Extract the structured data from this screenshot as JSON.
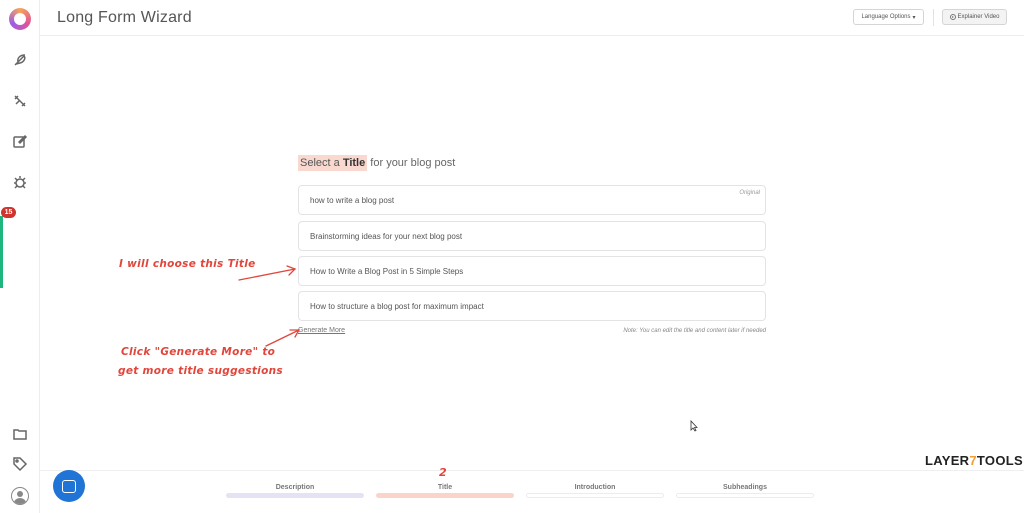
{
  "header": {
    "title": "Long Form Wizard",
    "language_button": "Language Options",
    "explainer_button": "Explainer Video"
  },
  "sidebar": {
    "notification_count": "15",
    "items": [
      {
        "icon": "feather-icon"
      },
      {
        "icon": "tools-icon"
      },
      {
        "icon": "edit-icon"
      },
      {
        "icon": "bug-icon"
      },
      {
        "icon": "folder-icon"
      },
      {
        "icon": "tag-icon"
      },
      {
        "icon": "avatar-icon"
      }
    ]
  },
  "picker": {
    "heading_prefix": "Select a",
    "heading_keyword": "Title",
    "heading_suffix": "for your blog post",
    "original_tag": "Original",
    "options": [
      "how to write a blog post",
      "Brainstorming ideas for your next blog post",
      "How to Write a Blog Post in 5 Simple Steps",
      "How to structure a blog post for maximum impact"
    ],
    "generate_more": "Generate More",
    "note": "Note: You can edit the title and content later if needed"
  },
  "annotations": {
    "choose_title": "I will choose this Title",
    "generate_line1": "Click \"Generate More\" to",
    "generate_line2": "get more title suggestions",
    "step_number": "2"
  },
  "steps": [
    {
      "label": "Description",
      "state": "complete"
    },
    {
      "label": "Title",
      "state": "active"
    },
    {
      "label": "Introduction",
      "state": "pending"
    },
    {
      "label": "Subheadings",
      "state": "pending"
    }
  ],
  "brand": {
    "part1": "LAYER",
    "part2": "7",
    "part3": "TOOLS"
  },
  "colors": {
    "accent": "#e0463b",
    "highlight": "#f8d8cf",
    "green": "#1fb57e",
    "chat": "#1f74d6"
  }
}
